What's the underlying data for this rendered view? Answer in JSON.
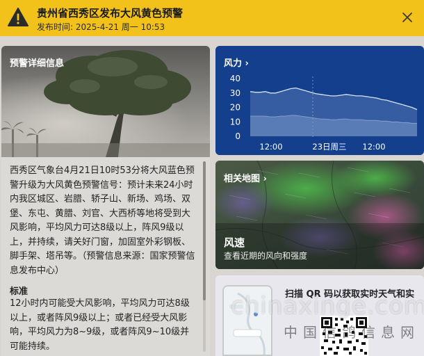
{
  "alert": {
    "title": "贵州省西秀区发布大风黄色预警",
    "time": "发布时间: 2025-4-21 周一 10:53",
    "icon": "warning-triangle-icon",
    "color": "#f2c21a"
  },
  "detail": {
    "heading": "预警详细信息",
    "body": "西秀区气象台4月21日10时53分将大风蓝色预警升级为大风黄色预警信号：预计未来24小时内我区城区、岩腊、轿子山、新场、鸡场、双堡、东屯、黄腊、刘官、大西桥等地将受到大风影响，平均风力可达8级以上，阵风9级以上，并持续，请关好门窗，加固室外彩钢板、脚手架、塔吊等。（预警信息来源：国家预警信息发布中心）",
    "standard_heading": "标准",
    "standard_body": "12小时内可能受大风影响，平均风力可达8级以上，或者阵风9级以上；或者已经受大风影响，平均风力为8~9级，或者阵风9~10级并可能持续。"
  },
  "wind": {
    "title": "风力 ›",
    "y_ticks": [
      "40",
      "30",
      "20",
      "10",
      "0"
    ],
    "x_ticks": [
      "12:00",
      "23日周三",
      "12:00"
    ]
  },
  "map": {
    "title": "相关地图 ›",
    "speed_label": "风速",
    "description": "查看近期的风向和强度"
  },
  "qr": {
    "text": "扫描 QR 码以获取实时天气和实"
  },
  "watermark": {
    "latin": "chinaxinge.com",
    "cn": "中国信鸽信息网"
  },
  "chart_data": {
    "type": "area",
    "title": "风力",
    "xlabel": "",
    "ylabel": "",
    "ylim": [
      0,
      40
    ],
    "x_ticks": [
      "12:00",
      "23日周三",
      "12:00"
    ],
    "series": [
      {
        "values": [
          31,
          30.5,
          30.5,
          31,
          30,
          30,
          31,
          32,
          33,
          33.5,
          32.5,
          31.5,
          30.5,
          29.5,
          29,
          28.5,
          28,
          28,
          28.5,
          29,
          28.5,
          28,
          28,
          27.5,
          27,
          26.5,
          25.5,
          25,
          24,
          23,
          22,
          21,
          20,
          18.5
        ]
      },
      {
        "values": [
          14,
          14,
          14,
          14,
          13.5,
          13.5,
          14,
          14,
          14.5,
          14.5,
          14,
          13.5,
          13,
          12.5,
          12,
          12,
          11.5,
          11.5,
          12,
          12,
          11.5,
          11.5,
          11.5,
          11,
          11,
          11,
          10.5,
          10.5,
          10,
          10,
          9.5,
          9.5,
          9,
          9
        ]
      }
    ]
  }
}
